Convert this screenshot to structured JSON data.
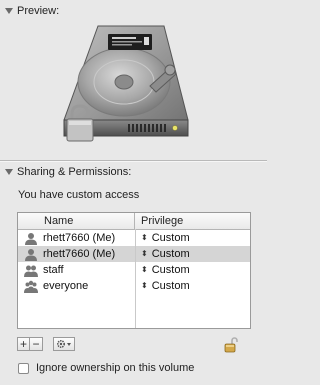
{
  "preview": {
    "header_label": "Preview:"
  },
  "sharing": {
    "header_label": "Sharing & Permissions:",
    "access_text": "You have custom access",
    "table": {
      "columns": [
        "Name",
        "Privilege"
      ],
      "rows": [
        {
          "name": "rhett7660 (Me)",
          "privilege": "Custom",
          "icon": "user-icon",
          "selected": false
        },
        {
          "name": "rhett7660 (Me)",
          "privilege": "Custom",
          "icon": "user-icon",
          "selected": true
        },
        {
          "name": "staff",
          "privilege": "Custom",
          "icon": "group-icon",
          "selected": false
        },
        {
          "name": "everyone",
          "privilege": "Custom",
          "icon": "everyone-icon",
          "selected": false
        }
      ]
    },
    "toolbar": {
      "add_label": "+",
      "remove_label": "−",
      "action_icon": "gear-icon"
    },
    "ignore_ownership": {
      "label": "Ignore ownership on this volume",
      "checked": false
    }
  },
  "colors": {
    "background": "#e8e8e8",
    "selected_row": "#d5d5d5"
  }
}
